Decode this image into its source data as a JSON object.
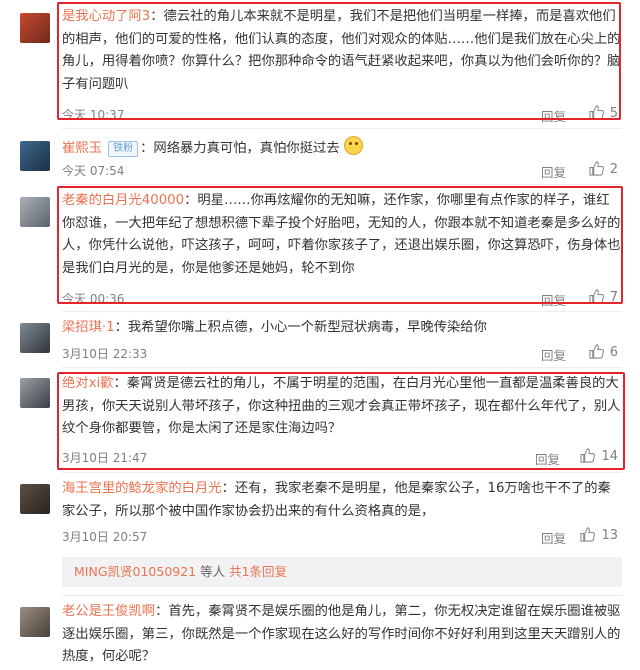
{
  "comments": [
    {
      "user": "是我心动了阿3",
      "text": "：德云社的角儿本来就不是明星，我们不是把他们当明星一样捧，而是喜欢他们的相声，他们的可爱的性格，他们认真的态度，他们对观众的体贴……他们是我们放在心尖上的角儿，用得着你喷？你算什么？把你那种命令的语气赶紧收起来吧，你真以为他们会听你的？脑子有问题叭",
      "time": "今天 10:37",
      "reply": "回复",
      "likes": "5"
    },
    {
      "user": "崔熙玉",
      "badge": "铁粉",
      "text": "：网络暴力真可怕，真怕你挺过去",
      "time": "今天 07:54",
      "reply": "回复",
      "likes": "2"
    },
    {
      "user": "老秦的白月光40000",
      "text": "：明星……你再炫耀你的无知嘛，还作家，你哪里有点作家的样子，谁红你怼谁，一大把年纪了想想积德下辈子投个好胎吧，无知的人，你跟本就不知道老秦是多么好的人，你凭什么说他，吓这孩子，呵呵，吓着你家孩子了，还退出娱乐圈，你这算恐吓，伤身体也是我们白月光的是，你是他爹还是她妈，轮不到你",
      "time": "今天 00:36",
      "reply": "回复",
      "likes": "7"
    },
    {
      "user": "梁招琪·1",
      "text": "：我希望你嘴上积点德，小心一个新型冠状病毒，早晚传染给你",
      "time": "3月10日 22:33",
      "reply": "回复",
      "likes": "6"
    },
    {
      "user": "绝对xi歡",
      "text": "：秦霄贤是德云社的角儿，不属于明星的范围，在白月光心里他一直都是温柔善良的大男孩，你天天说别人带坏孩子，你这种扭曲的三观才会真正带坏孩子，现在都什么年代了，别人纹个身你都要管，你是太闲了还是家住海边吗？",
      "time": "3月10日 21:47",
      "reply": "回复",
      "likes": "14"
    },
    {
      "user": "海王宫里的鲶龙家的白月光",
      "text": "：还有，我家老秦不是明星，他是秦家公子，16万啥也干不了的秦家公子，所以那个被中国作家协会扔出来的有什么资格真的是，",
      "time": "3月10日 20:57",
      "reply": "回复",
      "likes": "13",
      "subreply": {
        "user": "MING凯贤01050921",
        "mid": " 等人 ",
        "link": "共1条回复"
      }
    },
    {
      "user": "老公是王俊凯啊",
      "text": "：首先，秦霄贤不是娱乐圈的他是角儿，第二，你无权决定谁留在娱乐圈谁被驱逐出娱乐圈，第三，你既然是一个作家现在这么好的写作时间你不好好利用到这里天天蹭别人的热度，何必呢？"
    }
  ],
  "colors": {
    "username": "#eb7350",
    "highlight_box": "#e3262d"
  },
  "icons": {
    "like": "thumbs-up-icon",
    "emoji": "smile-emoji-icon"
  }
}
